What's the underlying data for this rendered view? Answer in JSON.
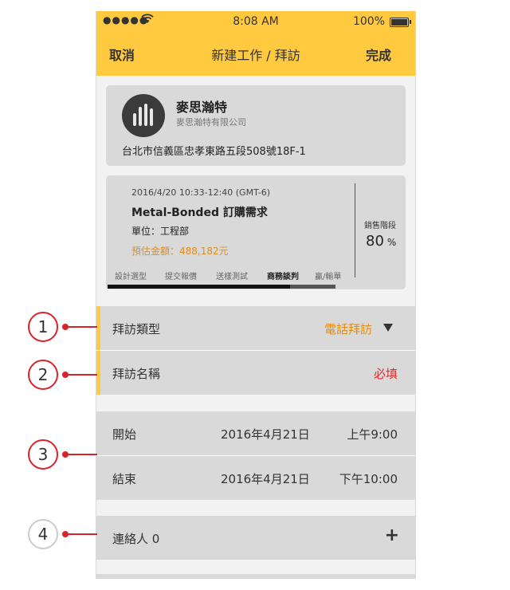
{
  "status_bar": {
    "signal": "●●●●●",
    "time": "8:08 AM",
    "battery": "100%"
  },
  "nav": {
    "cancel": "取消",
    "title": "新建工作 / 拜訪",
    "done": "完成"
  },
  "customer": {
    "name": "麥思瀚特",
    "company": "麥思瀚特有限公司",
    "address": "台北市信義區忠孝東路五段508號18F-1"
  },
  "opportunity": {
    "datetime": "2016/4/20 10:33-12:40 (GMT-6)",
    "product": "Metal-Bonded 訂購需求",
    "unit": "單位：工程部",
    "amount": "預估金額：488,182元",
    "stage_label": "銷售階段",
    "stage_value": "80",
    "stage_unit": "%",
    "stages": [
      "設計選型",
      "提交報價",
      "送樣測試",
      "商務談判",
      "贏/輸單"
    ],
    "active_stage": 3,
    "progress_fraction": 0.8
  },
  "form": {
    "visit_type_label": "拜訪類型",
    "visit_type_value": "電話拜訪",
    "visit_name_label": "拜訪名稱",
    "visit_name_value": "必填",
    "start_label": "開始",
    "start_date": "2016年4月21日",
    "start_time": "上午9:00",
    "end_label": "結束",
    "end_date": "2016年4月21日",
    "end_time": "下午10:00",
    "contacts_label": "連絡人 0",
    "add_icon": "+"
  },
  "callouts": [
    "1",
    "2",
    "3",
    "4"
  ],
  "colors": {
    "accent": "#ffc940",
    "orange": "#e08e1a",
    "required": "#e02b2b",
    "callout": "#d9232a"
  }
}
